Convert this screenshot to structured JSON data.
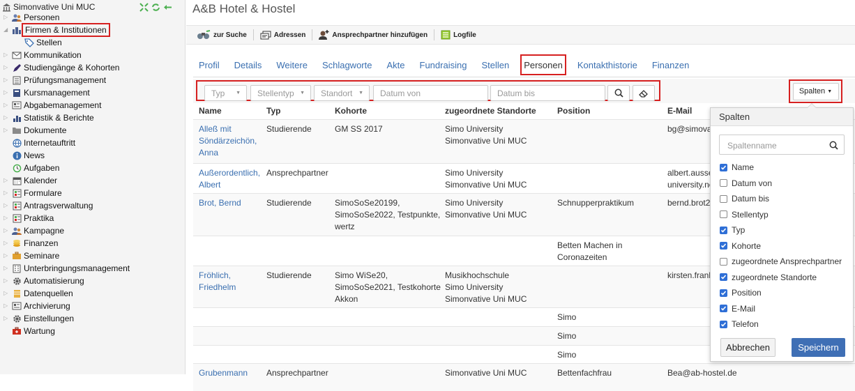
{
  "sidebar": {
    "root": "Simonvative Uni MUC",
    "items": [
      {
        "label": "Personen",
        "icon": "people-icon",
        "expanded": false
      },
      {
        "label": "Firmen & Institutionen",
        "icon": "building-icon",
        "expanded": true,
        "highlight": true
      },
      {
        "label": "Stellen",
        "icon": "tag-icon",
        "sub": true
      },
      {
        "label": "Kommunikation",
        "icon": "envelope-icon"
      },
      {
        "label": "Studiengänge & Kohorten",
        "icon": "pen-icon"
      },
      {
        "label": "Prüfungsmanagement",
        "icon": "checklist-icon"
      },
      {
        "label": "Kursmanagement",
        "icon": "book-icon"
      },
      {
        "label": "Abgabemanagement",
        "icon": "card-icon"
      },
      {
        "label": "Statistik & Berichte",
        "icon": "bar-chart-icon"
      },
      {
        "label": "Dokumente",
        "icon": "folder-icon"
      },
      {
        "label": "Internetauftritt",
        "icon": "globe-icon"
      },
      {
        "label": "News",
        "icon": "info-icon"
      },
      {
        "label": "Aufgaben",
        "icon": "clock-icon"
      },
      {
        "label": "Kalender",
        "icon": "calendar-icon"
      },
      {
        "label": "Formulare",
        "icon": "form-icon"
      },
      {
        "label": "Antragsverwaltung",
        "icon": "form-icon"
      },
      {
        "label": "Praktika",
        "icon": "form-icon"
      },
      {
        "label": "Kampagne",
        "icon": "people-icon"
      },
      {
        "label": "Finanzen",
        "icon": "coins-icon"
      },
      {
        "label": "Seminare",
        "icon": "briefcase-icon"
      },
      {
        "label": "Unterbringungsmanagement",
        "icon": "building2-icon"
      },
      {
        "label": "Automatisierung",
        "icon": "gear-icon"
      },
      {
        "label": "Datenquellen",
        "icon": "database-icon"
      },
      {
        "label": "Archivierung",
        "icon": "card-icon"
      },
      {
        "label": "Einstellungen",
        "icon": "gear-icon"
      },
      {
        "label": "Wartung",
        "icon": "toolbox-icon"
      }
    ]
  },
  "header": {
    "title": "A&B Hotel & Hostel"
  },
  "toolbar": {
    "search": "zur Suche",
    "addresses": "Adressen",
    "add_contact": "Ansprechpartner hinzufügen",
    "logfile": "Logfile"
  },
  "tabs": [
    "Profil",
    "Details",
    "Weitere",
    "Schlagworte",
    "Akte",
    "Fundraising",
    "Stellen",
    "Personen",
    "Kontakthistorie",
    "Finanzen"
  ],
  "active_tab": "Personen",
  "filters": {
    "typ": "Typ",
    "stellentyp": "Stellentyp",
    "standort": "Standort",
    "datum_von": "Datum von",
    "datum_bis": "Datum bis",
    "columns_button": "Spalten"
  },
  "table": {
    "columns": [
      "Name",
      "Typ",
      "Kohorte",
      "zugeordnete Standorte",
      "Position",
      "E-Mail"
    ],
    "rows": [
      {
        "name": [
          "Alleß mit",
          "Söndärzeichön,",
          "Anna"
        ],
        "typ": "Studierende",
        "kohorte": [
          "GM SS 2017"
        ],
        "standorte": [
          "Simo University",
          "Simonvative Uni MUC"
        ],
        "position": [],
        "email": [
          "bg@simova"
        ]
      },
      {
        "name": [
          "Außerordentlich,",
          "Albert"
        ],
        "typ": "Ansprechpartner",
        "kohorte": [],
        "standorte": [
          "Simo University",
          "Simonvative Uni MUC"
        ],
        "position": [],
        "email": [
          "albert.ausse",
          "university.ne"
        ]
      },
      {
        "name": [
          "Brot, Bernd"
        ],
        "typ": "Studierende",
        "kohorte": [
          "SimoSoSe20199,",
          "SimoSoSe2022, Testpunkte,",
          "wertz"
        ],
        "standorte": [
          "Simo University",
          "Simonvative Uni MUC"
        ],
        "position": [
          "Schnupperpraktikum"
        ],
        "email": [
          "bernd.brot2"
        ]
      },
      {
        "name": [],
        "typ": "",
        "kohorte": [],
        "standorte": [],
        "position": [
          "Betten Machen in",
          "Coronazeiten"
        ],
        "email": []
      },
      {
        "name": [
          "Fröhlich,",
          "Friedhelm"
        ],
        "typ": "Studierende",
        "kohorte": [
          "Simo WiSe20,",
          "SimoSoSe2021, Testkohorte",
          "Akkon"
        ],
        "standorte": [
          "Musikhochschule",
          "Simo University",
          "Simonvative Uni MUC"
        ],
        "position": [],
        "email": [
          "kirsten.frank"
        ]
      },
      {
        "name": [],
        "typ": "",
        "kohorte": [],
        "standorte": [],
        "position": [
          "Simo"
        ],
        "email": []
      },
      {
        "name": [],
        "typ": "",
        "kohorte": [],
        "standorte": [],
        "position": [
          "Simo"
        ],
        "email": []
      },
      {
        "name": [],
        "typ": "",
        "kohorte": [],
        "standorte": [],
        "position": [
          "Simo"
        ],
        "email": []
      },
      {
        "name": [
          "Grubenmann"
        ],
        "typ": "Ansprechpartner",
        "kohorte": [],
        "standorte": [
          "Simonvative Uni MUC"
        ],
        "position": [
          "Bettenfachfrau"
        ],
        "email": [
          "Bea@ab-hostel.de"
        ]
      }
    ]
  },
  "columns_panel": {
    "title": "Spalten",
    "search_placeholder": "Spaltenname",
    "options": [
      {
        "label": "Name",
        "checked": true
      },
      {
        "label": "Datum von",
        "checked": false
      },
      {
        "label": "Datum bis",
        "checked": false
      },
      {
        "label": "Stellentyp",
        "checked": false
      },
      {
        "label": "Typ",
        "checked": true
      },
      {
        "label": "Kohorte",
        "checked": true
      },
      {
        "label": "zugeordnete Ansprechpartner",
        "checked": false
      },
      {
        "label": "zugeordnete Standorte",
        "checked": true
      },
      {
        "label": "Position",
        "checked": true
      },
      {
        "label": "E-Mail",
        "checked": true
      },
      {
        "label": "Telefon",
        "checked": true
      }
    ],
    "cancel": "Abbrechen",
    "save": "Speichern"
  },
  "colors": {
    "accent": "#3f6fb5",
    "link": "#3a6fb0",
    "highlight": "#d62020",
    "checkbox": "#2f6fd6"
  }
}
